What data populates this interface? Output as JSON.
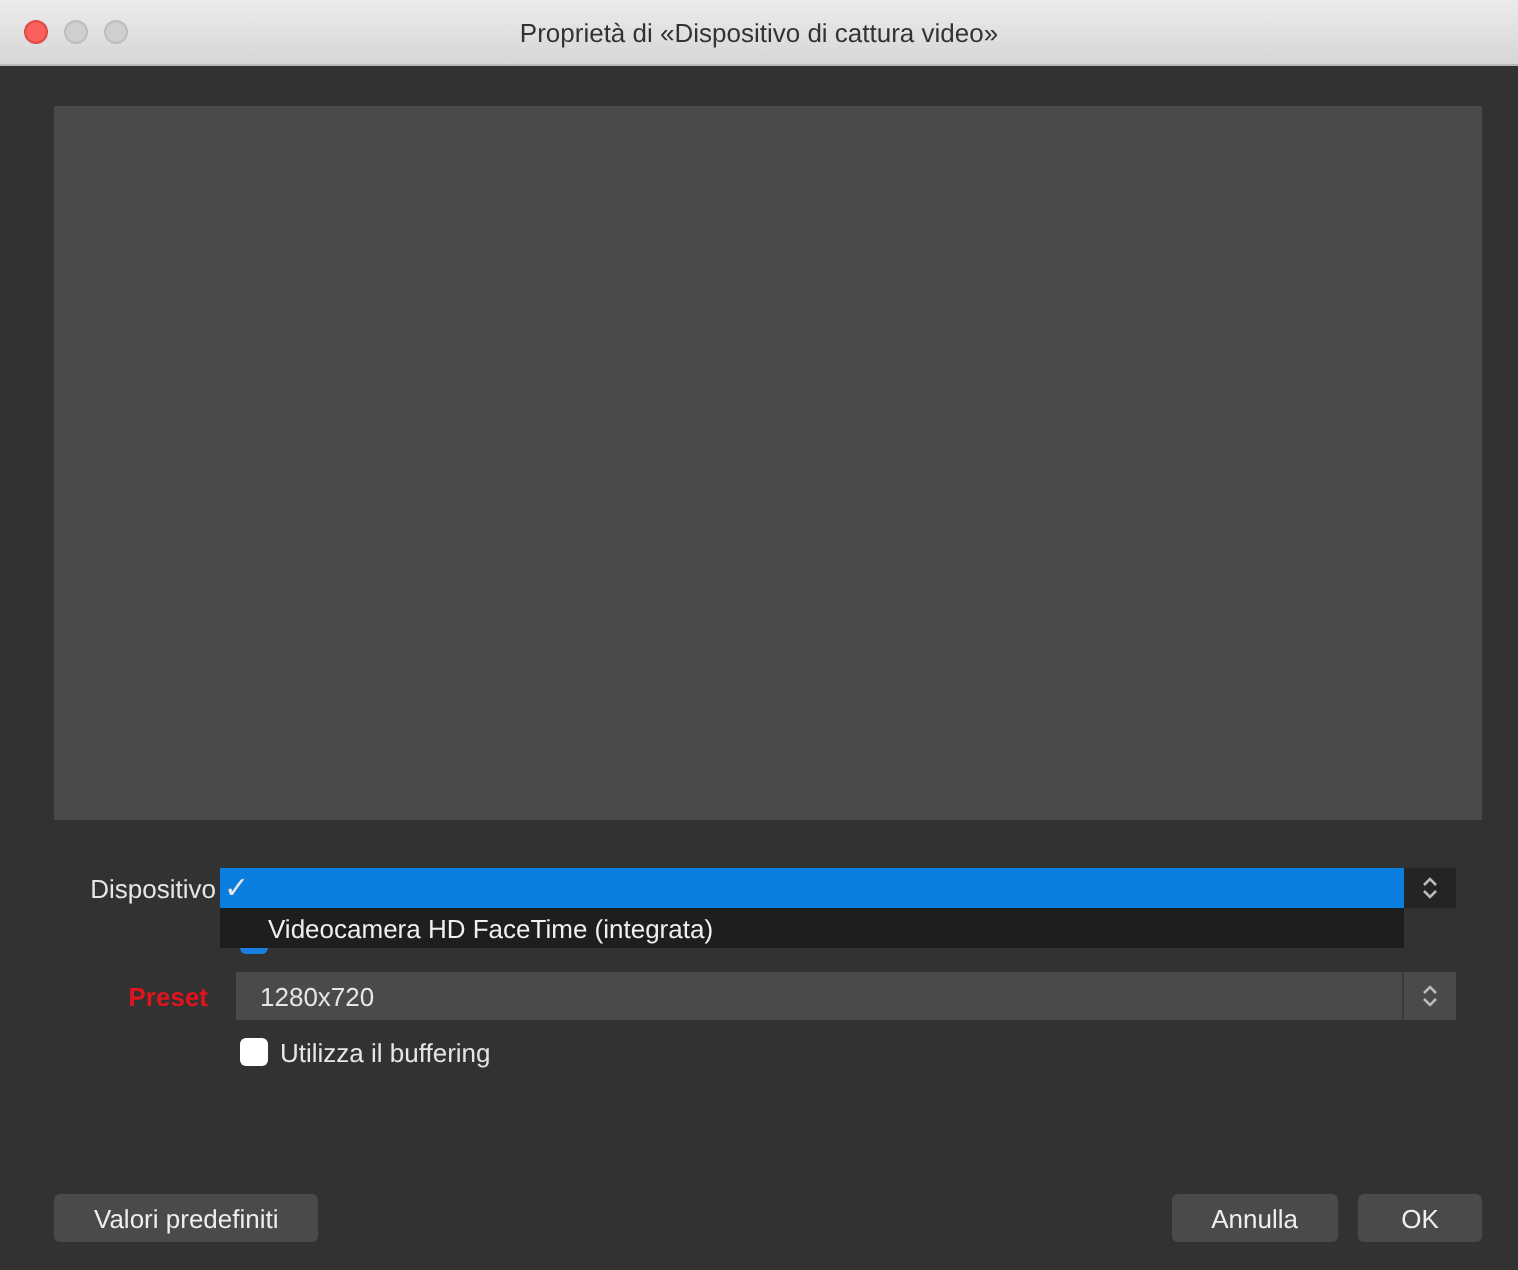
{
  "window": {
    "title": "Proprietà di «Dispositivo di cattura video»"
  },
  "preview": {
    "kind": "empty"
  },
  "device": {
    "label": "Dispositivo",
    "open": true,
    "options": [
      {
        "mark": "✓",
        "selected": true
      },
      {
        "label": "Videocamera HD FaceTime (integrata)",
        "selected": false
      }
    ]
  },
  "use_preset": {
    "checked": true
  },
  "preset": {
    "label": "Preset",
    "value": "1280x720"
  },
  "buffering": {
    "label": "Utilizza il buffering",
    "checked": false
  },
  "buttons": {
    "defaults": "Valori predefiniti",
    "cancel": "Annulla",
    "ok": "OK"
  }
}
